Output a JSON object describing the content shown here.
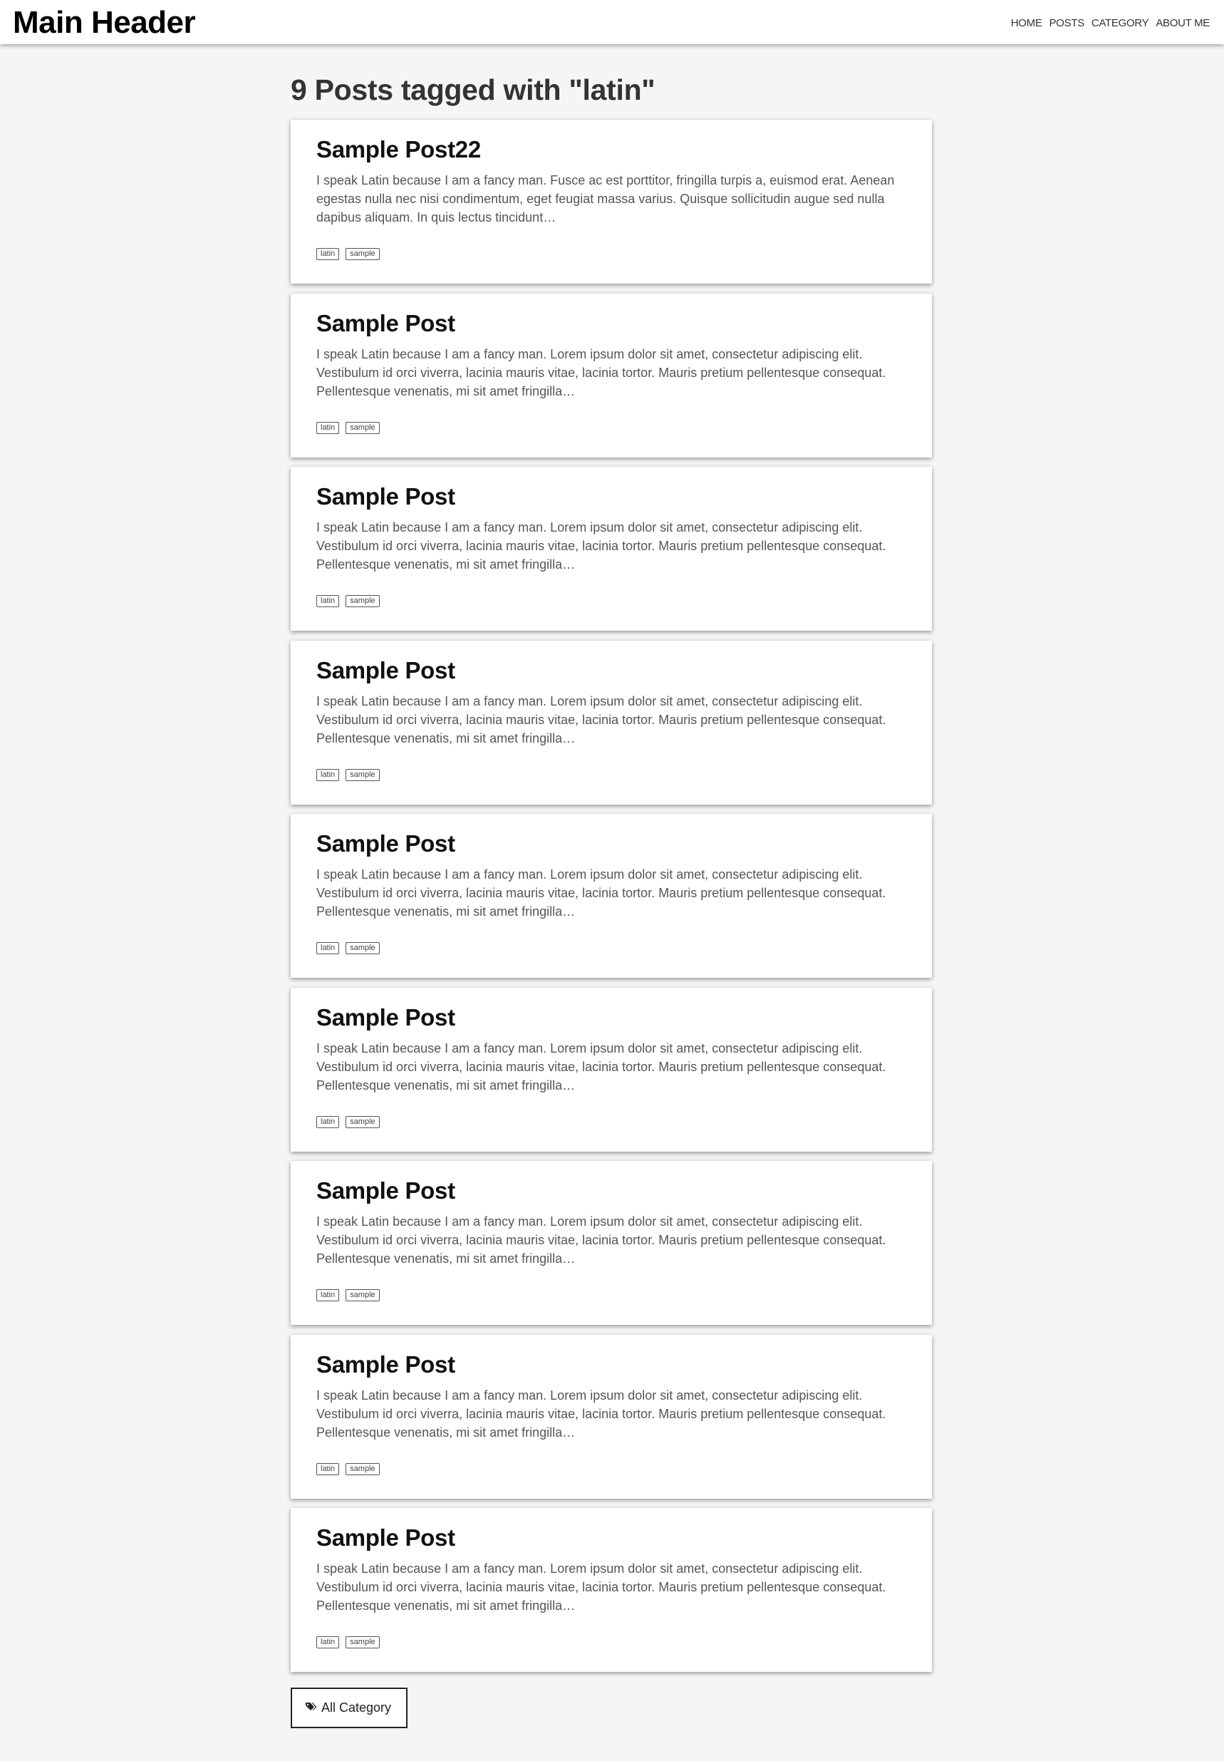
{
  "header": {
    "brand": "Main Header",
    "nav": [
      {
        "label": "HOME"
      },
      {
        "label": "POSTS"
      },
      {
        "label": "CATEGORY"
      },
      {
        "label": "ABOUT ME"
      }
    ]
  },
  "page": {
    "title": "9 Posts tagged with \"latin\""
  },
  "posts": [
    {
      "title": "Sample Post22",
      "excerpt": "I speak Latin because I am a fancy man. Fusce ac est porttitor, fringilla turpis a, euismod erat. Aenean egestas nulla nec nisi condimentum, eget feugiat massa varius. Quisque sollicitudin augue sed nulla dapibus aliquam. In quis lectus tincidunt…",
      "tags": [
        "latin",
        "sample"
      ]
    },
    {
      "title": "Sample Post",
      "excerpt": "I speak Latin because I am a fancy man. Lorem ipsum dolor sit amet, consectetur adipiscing elit. Vestibulum id orci viverra, lacinia mauris vitae, lacinia tortor. Mauris pretium pellentesque consequat. Pellentesque venenatis, mi sit amet fringilla…",
      "tags": [
        "latin",
        "sample"
      ]
    },
    {
      "title": "Sample Post",
      "excerpt": "I speak Latin because I am a fancy man. Lorem ipsum dolor sit amet, consectetur adipiscing elit. Vestibulum id orci viverra, lacinia mauris vitae, lacinia tortor. Mauris pretium pellentesque consequat. Pellentesque venenatis, mi sit amet fringilla…",
      "tags": [
        "latin",
        "sample"
      ]
    },
    {
      "title": "Sample Post",
      "excerpt": "I speak Latin because I am a fancy man. Lorem ipsum dolor sit amet, consectetur adipiscing elit. Vestibulum id orci viverra, lacinia mauris vitae, lacinia tortor. Mauris pretium pellentesque consequat. Pellentesque venenatis, mi sit amet fringilla…",
      "tags": [
        "latin",
        "sample"
      ]
    },
    {
      "title": "Sample Post",
      "excerpt": "I speak Latin because I am a fancy man. Lorem ipsum dolor sit amet, consectetur adipiscing elit. Vestibulum id orci viverra, lacinia mauris vitae, lacinia tortor. Mauris pretium pellentesque consequat. Pellentesque venenatis, mi sit amet fringilla…",
      "tags": [
        "latin",
        "sample"
      ]
    },
    {
      "title": "Sample Post",
      "excerpt": "I speak Latin because I am a fancy man. Lorem ipsum dolor sit amet, consectetur adipiscing elit. Vestibulum id orci viverra, lacinia mauris vitae, lacinia tortor. Mauris pretium pellentesque consequat. Pellentesque venenatis, mi sit amet fringilla…",
      "tags": [
        "latin",
        "sample"
      ]
    },
    {
      "title": "Sample Post",
      "excerpt": "I speak Latin because I am a fancy man. Lorem ipsum dolor sit amet, consectetur adipiscing elit. Vestibulum id orci viverra, lacinia mauris vitae, lacinia tortor. Mauris pretium pellentesque consequat. Pellentesque venenatis, mi sit amet fringilla…",
      "tags": [
        "latin",
        "sample"
      ]
    },
    {
      "title": "Sample Post",
      "excerpt": "I speak Latin because I am a fancy man. Lorem ipsum dolor sit amet, consectetur adipiscing elit. Vestibulum id orci viverra, lacinia mauris vitae, lacinia tortor. Mauris pretium pellentesque consequat. Pellentesque venenatis, mi sit amet fringilla…",
      "tags": [
        "latin",
        "sample"
      ]
    },
    {
      "title": "Sample Post",
      "excerpt": "I speak Latin because I am a fancy man. Lorem ipsum dolor sit amet, consectetur adipiscing elit. Vestibulum id orci viverra, lacinia mauris vitae, lacinia tortor. Mauris pretium pellentesque consequat. Pellentesque venenatis, mi sit amet fringilla…",
      "tags": [
        "latin",
        "sample"
      ]
    }
  ],
  "footer_button": {
    "label": "All Category",
    "icon": "tags-icon"
  }
}
